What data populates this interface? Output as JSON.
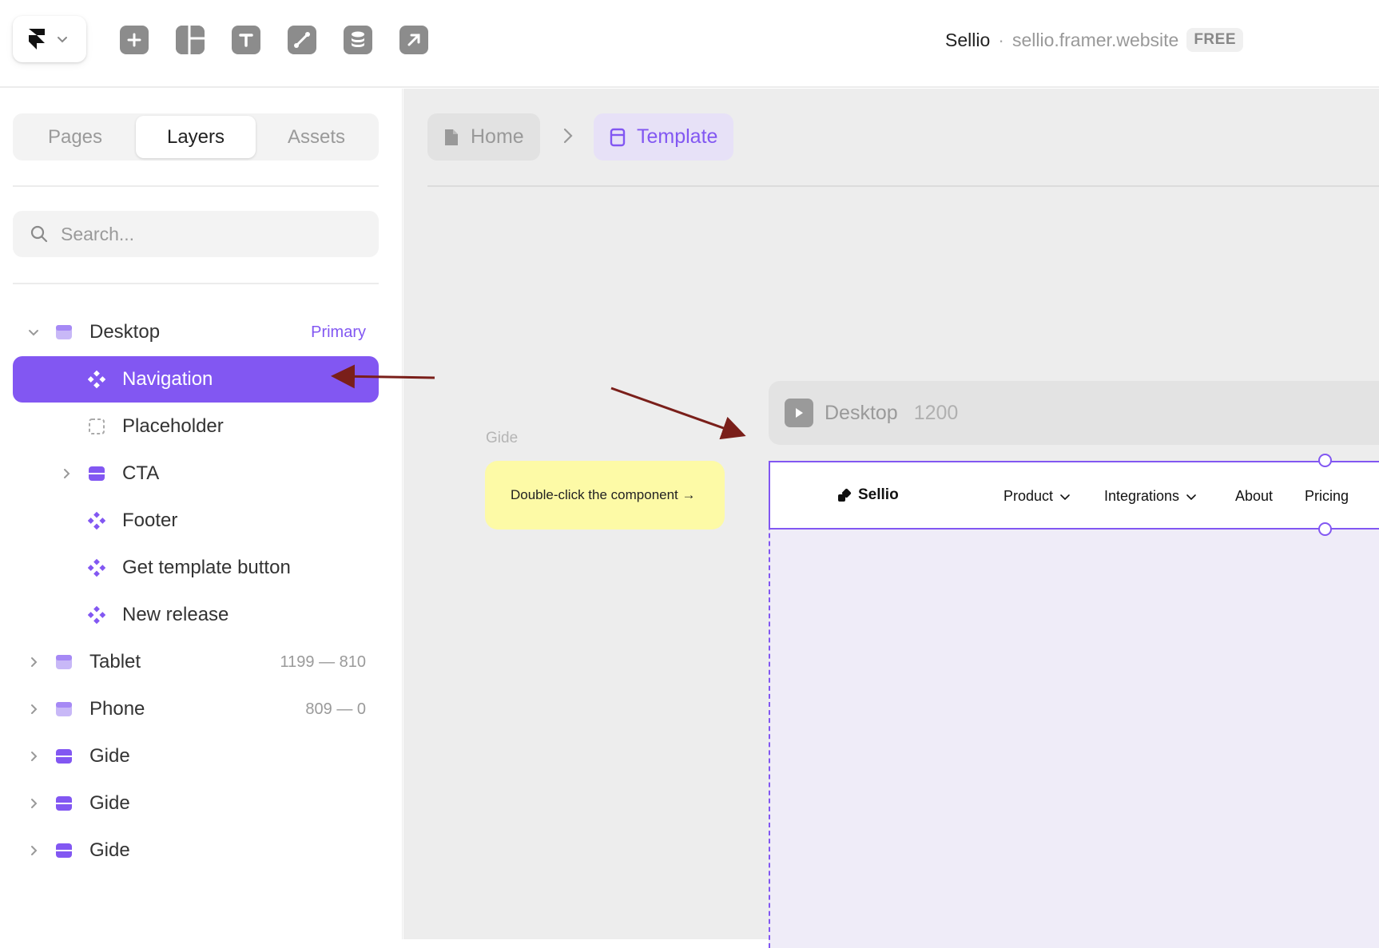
{
  "toolbar": {
    "logo_icon": "framer-logo-icon",
    "tools": [
      "plus-icon",
      "layout-icon",
      "text-icon",
      "vector-icon",
      "database-icon",
      "arrow-up-right-icon"
    ]
  },
  "site": {
    "name": "Sellio",
    "separator": "·",
    "url": "sellio.framer.website",
    "plan": "FREE"
  },
  "panel": {
    "tabs": [
      {
        "label": "Pages"
      },
      {
        "label": "Layers",
        "active": true
      },
      {
        "label": "Assets"
      }
    ],
    "search_placeholder": "Search..."
  },
  "layers": [
    {
      "name": "Desktop",
      "meta": "Primary",
      "type": "breakpoint",
      "expanded": true
    },
    {
      "name": "Navigation",
      "type": "component",
      "selected": true
    },
    {
      "name": "Placeholder",
      "type": "placeholder"
    },
    {
      "name": "CTA",
      "type": "frame",
      "collapsed": true
    },
    {
      "name": "Footer",
      "type": "component"
    },
    {
      "name": "Get template button",
      "type": "component"
    },
    {
      "name": "New release",
      "type": "component"
    },
    {
      "name": "Tablet",
      "meta": "1199 — 810",
      "type": "breakpoint",
      "collapsed": true
    },
    {
      "name": "Phone",
      "meta": "809 — 0",
      "type": "breakpoint",
      "collapsed": true
    },
    {
      "name": "Gide",
      "type": "frame",
      "collapsed": true
    },
    {
      "name": "Gide",
      "type": "frame",
      "collapsed": true
    },
    {
      "name": "Gide",
      "type": "frame",
      "collapsed": true
    }
  ],
  "breadcrumb": {
    "home": "Home",
    "current": "Template"
  },
  "canvas": {
    "note_label": "Gide",
    "note_text": "Double-click the component →",
    "frame_title": "Desktop",
    "frame_width": "1200",
    "nav": {
      "brand": "Sellio",
      "items": [
        "Product",
        "Integrations",
        "About",
        "Pricing"
      ]
    }
  },
  "colors": {
    "accent": "#8257f2",
    "note_bg": "#fdfaa6",
    "annotation_arrow": "#7a1f1a"
  }
}
